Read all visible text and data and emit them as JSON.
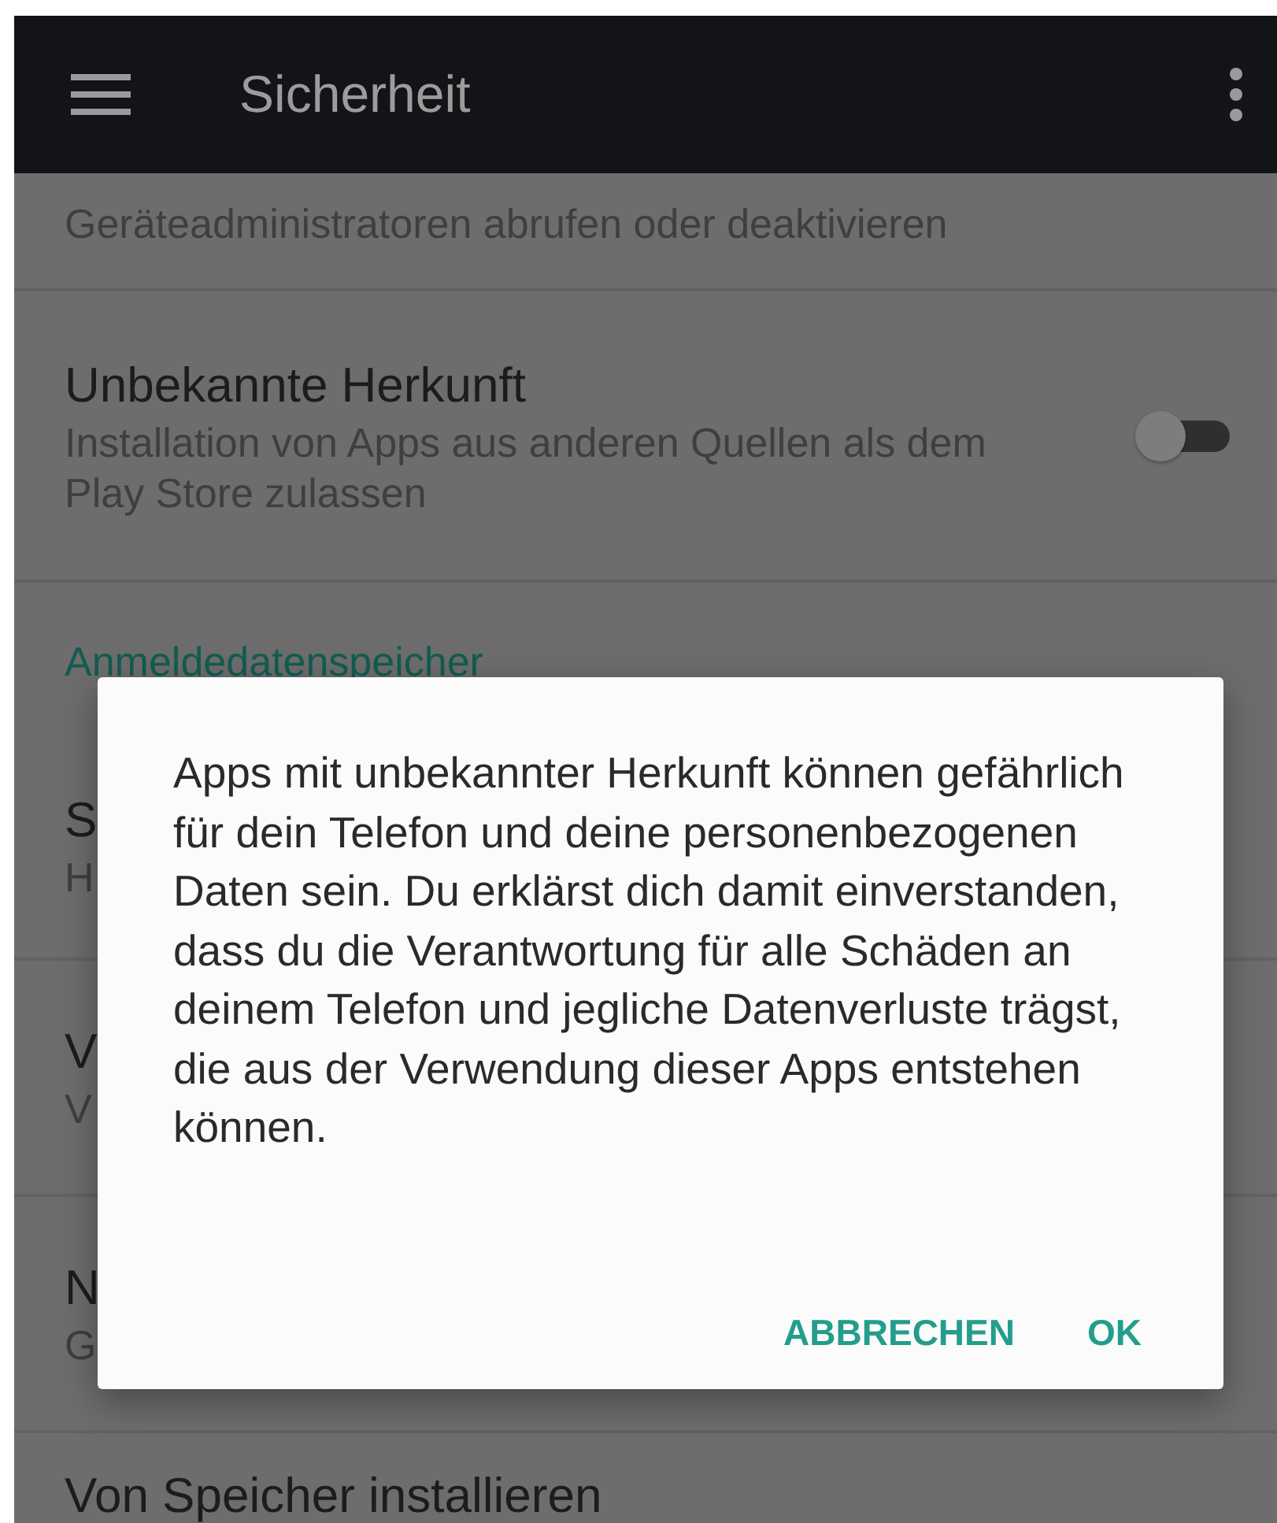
{
  "app_bar": {
    "title": "Sicherheit"
  },
  "settings": [
    {
      "kind": "subtitle",
      "subtitle": "Geräteadministratoren abrufen oder deaktivieren"
    },
    {
      "kind": "toggle",
      "title": "Unbekannte Herkunft",
      "subtitle": "Installation von Apps aus anderen Quellen als dem Play Store zulassen",
      "on": false
    },
    {
      "kind": "header",
      "title": "Anmeldedatenspeicher"
    },
    {
      "kind": "item",
      "title": "S",
      "subtitle": "H"
    },
    {
      "kind": "item",
      "title": "V",
      "subtitle": "V"
    },
    {
      "kind": "item",
      "title": "N",
      "subtitle": "G"
    },
    {
      "kind": "item",
      "title": "Von Speicher installieren"
    }
  ],
  "dialog": {
    "message": "Apps mit unbekannter Herkunft können gefährlich für dein Telefon und deine personenbezogenen Daten sein. Du erklärst dich damit einverstanden, dass du die Verantwortung für alle Schäden an deinem Telefon und jegliche Datenverluste trägst, die aus der Verwendung dieser Apps entstehen können.",
    "buttons": [
      "ABBRECHEN",
      "OK"
    ]
  }
}
